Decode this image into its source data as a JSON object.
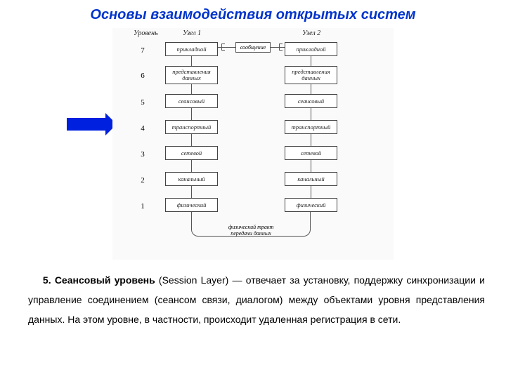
{
  "title": "Основы взаимодействия открытых систем",
  "diagram": {
    "headers": {
      "level": "Уровень",
      "node1": "Узел 1",
      "node2": "Узел 2"
    },
    "message_label": "сообщение",
    "physical_path": "физический тракт\nпередачи данных",
    "levels": [
      "7",
      "6",
      "5",
      "4",
      "3",
      "2",
      "1"
    ],
    "layers": [
      "прикладной",
      "представления данных",
      "сеансовый",
      "транспортный",
      "сетевой",
      "канальный",
      "физический"
    ],
    "highlighted_layer_index": 2
  },
  "paragraph": {
    "lead": "5. Сеансовый уровень",
    "rest": " (Session Layer) — отвечает за установку, поддержку синхронизации и управление соединением (сеансом связи, диалогом) между объектами уровня представления данных. На этом уровне, в частности, происходит удаленная регистрация в сети."
  }
}
